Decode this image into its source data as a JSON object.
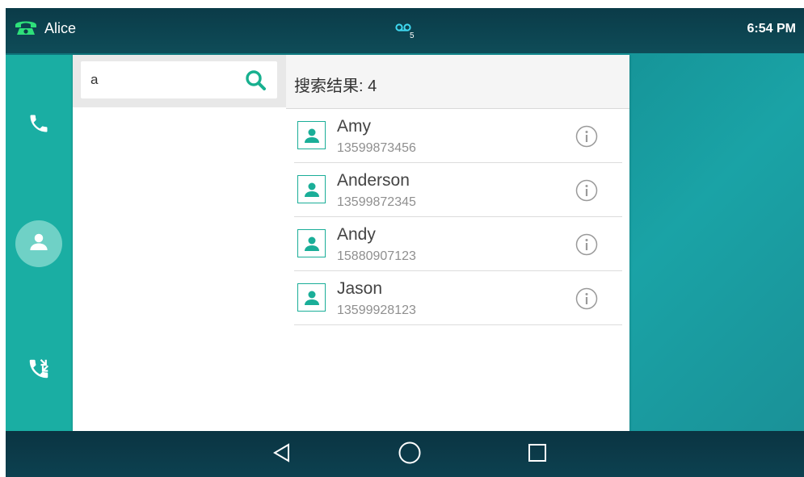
{
  "status_bar": {
    "account": "Alice",
    "voicemail_count": "5",
    "time": "6:54 PM"
  },
  "rail": {
    "items": [
      {
        "icon": "phone-icon"
      },
      {
        "icon": "contacts-icon",
        "active": true
      },
      {
        "icon": "call-history-icon"
      }
    ]
  },
  "search": {
    "value": "a",
    "placeholder": ""
  },
  "results": {
    "title": "搜索结果: 4",
    "contacts": [
      {
        "name": "Amy",
        "number": "13599873456"
      },
      {
        "name": "Anderson",
        "number": "13599872345"
      },
      {
        "name": "Andy",
        "number": "15880907123"
      },
      {
        "name": "Jason",
        "number": "13599928123"
      }
    ]
  },
  "colors": {
    "accent": "#1aae98",
    "rail": "#1aaea3",
    "status_bar": "#0b3b48"
  }
}
